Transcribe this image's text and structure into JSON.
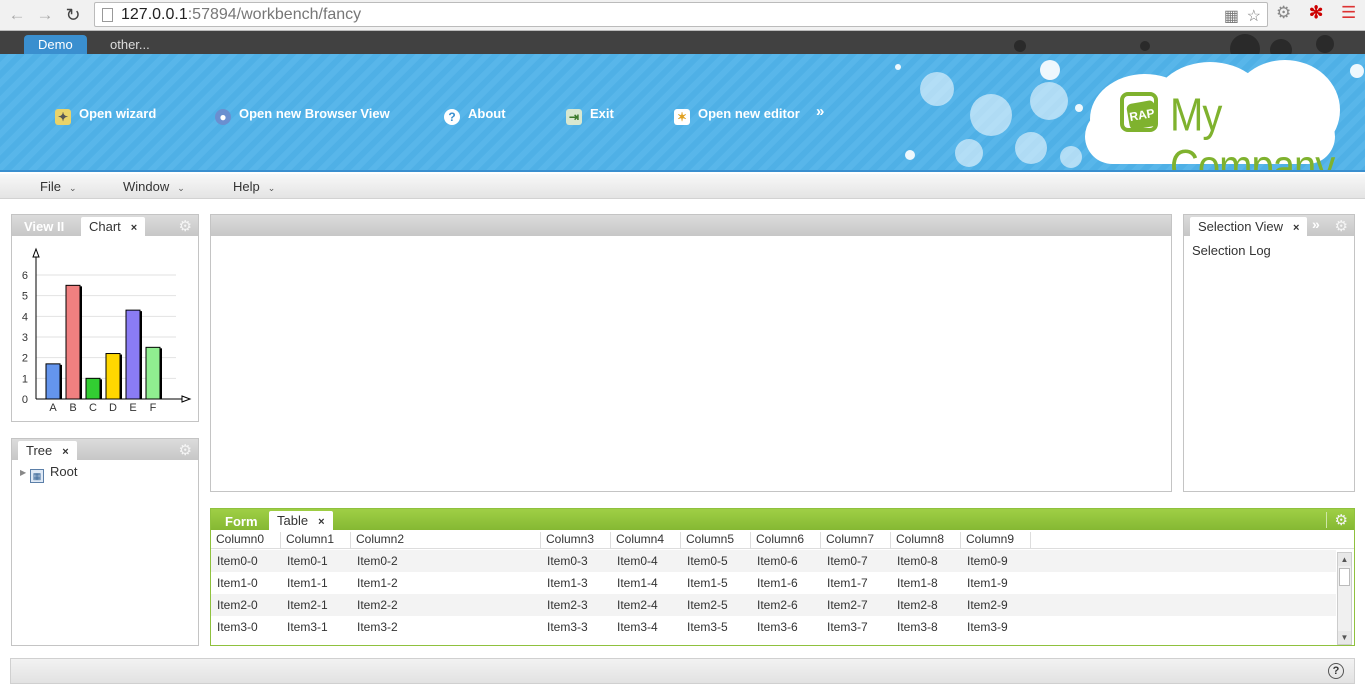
{
  "browser": {
    "url_host": "127.0.0.1",
    "url_rest": ":57894/workbench/fancy"
  },
  "perspectives": [
    {
      "label": "Demo",
      "active": true
    },
    {
      "label": "other...",
      "active": false
    }
  ],
  "toolbar": {
    "items": [
      {
        "label": "Open wizard",
        "icon": "wand-icon"
      },
      {
        "label": "Open new Browser View",
        "icon": "globe-icon"
      },
      {
        "label": "About",
        "icon": "question-icon"
      },
      {
        "label": "Exit",
        "icon": "exit-icon"
      },
      {
        "label": "Open new editor",
        "icon": "new-editor-icon"
      }
    ],
    "overflow_glyph": "»"
  },
  "brand": {
    "logo_badge": "RAP",
    "company": "My Company"
  },
  "menu": {
    "items": [
      {
        "label": "File"
      },
      {
        "label": "Window"
      },
      {
        "label": "Help"
      }
    ]
  },
  "left_top_panel": {
    "tabs": [
      {
        "label": "View II",
        "active": false
      },
      {
        "label": "Chart",
        "active": true,
        "close": "×"
      }
    ]
  },
  "chart_data": {
    "type": "bar",
    "title": "",
    "xlabel": "",
    "ylabel": "",
    "categories": [
      "A",
      "B",
      "C",
      "D",
      "E",
      "F"
    ],
    "values": [
      1.7,
      5.5,
      1.0,
      2.2,
      4.3,
      2.5
    ],
    "colors": [
      "#6495ed",
      "#f08080",
      "#32cd32",
      "#ffd700",
      "#8a7cf5",
      "#90ee90"
    ],
    "yticks": [
      0,
      1,
      2,
      3,
      4,
      5,
      6
    ],
    "ylim": [
      0,
      6.5
    ],
    "grid": true,
    "legend": "none"
  },
  "tree_panel": {
    "tab": {
      "label": "Tree",
      "close": "×"
    },
    "root_label": "Root"
  },
  "selection_panel": {
    "tab": {
      "label": "Selection View",
      "close": "×"
    },
    "overflow_glyph": "»",
    "log_label": "Selection Log"
  },
  "bottom_panel": {
    "tabs": [
      {
        "label": "Form",
        "active": false
      },
      {
        "label": "Table",
        "active": true,
        "close": "×"
      }
    ],
    "columns": [
      "Column0",
      "Column1",
      "Column2",
      "Column3",
      "Column4",
      "Column5",
      "Column6",
      "Column7",
      "Column8",
      "Column9"
    ],
    "rows": [
      [
        "Item0-0",
        "Item0-1",
        "Item0-2",
        "Item0-3",
        "Item0-4",
        "Item0-5",
        "Item0-6",
        "Item0-7",
        "Item0-8",
        "Item0-9"
      ],
      [
        "Item1-0",
        "Item1-1",
        "Item1-2",
        "Item1-3",
        "Item1-4",
        "Item1-5",
        "Item1-6",
        "Item1-7",
        "Item1-8",
        "Item1-9"
      ],
      [
        "Item2-0",
        "Item2-1",
        "Item2-2",
        "Item2-3",
        "Item2-4",
        "Item2-5",
        "Item2-6",
        "Item2-7",
        "Item2-8",
        "Item2-9"
      ],
      [
        "Item3-0",
        "Item3-1",
        "Item3-2",
        "Item3-3",
        "Item3-4",
        "Item3-5",
        "Item3-6",
        "Item3-7",
        "Item3-8",
        "Item3-9"
      ]
    ]
  },
  "status_bar": {
    "help_glyph": "?"
  }
}
